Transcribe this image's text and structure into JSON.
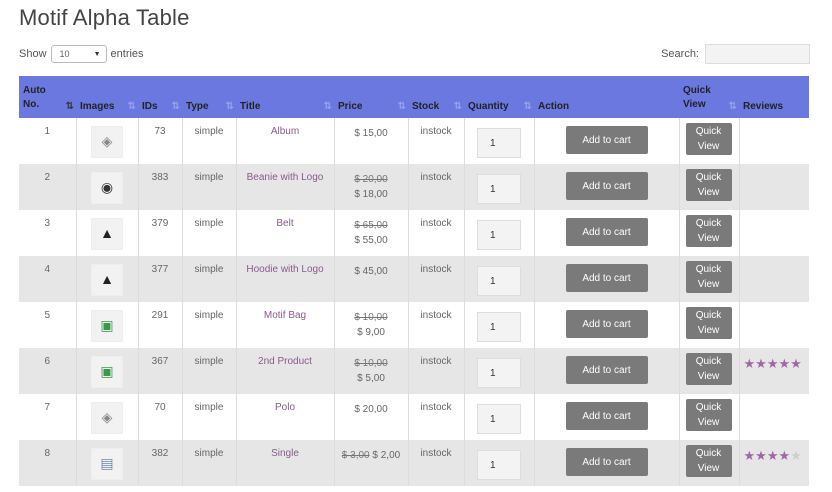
{
  "page": {
    "title": "Motif Alpha Table"
  },
  "controls": {
    "show_label": "Show",
    "entries_value": "10",
    "entries_label": "entries",
    "search_label": "Search:"
  },
  "table": {
    "headers": {
      "auto_no": "Auto No.",
      "images": "Images",
      "ids": "IDs",
      "type": "Type",
      "title": "Title",
      "price": "Price",
      "stock": "Stock",
      "quantity": "Quantity",
      "action": "Action",
      "quick_view": "Quick View",
      "reviews": "Reviews"
    },
    "rows": [
      {
        "no": "1",
        "id": "73",
        "type": "simple",
        "title": "Album",
        "old_price": "",
        "price": "$ 15,00",
        "stock": "instock",
        "qty": "1",
        "action": "Add to cart",
        "qv1": "Quick",
        "qv2": "View",
        "rating": 0,
        "thumb": "cd-icon"
      },
      {
        "no": "2",
        "id": "383",
        "type": "simple",
        "title": "Beanie with Logo",
        "old_price": "$ 20,00",
        "price": "$ 18,00",
        "stock": "instock",
        "qty": "1",
        "action": "Add to cart",
        "qv1": "Quick",
        "qv2": "View",
        "rating": 0,
        "thumb": "beanie-icon"
      },
      {
        "no": "3",
        "id": "379",
        "type": "simple",
        "title": "Belt",
        "old_price": "$ 65,00",
        "price": "$ 55,00",
        "stock": "instock",
        "qty": "1",
        "action": "Add to cart",
        "qv1": "Quick",
        "qv2": "View",
        "rating": 0,
        "thumb": "hoodie-icon"
      },
      {
        "no": "4",
        "id": "377",
        "type": "simple",
        "title": "Hoodie with Logo",
        "old_price": "",
        "price": "$ 45,00",
        "stock": "instock",
        "qty": "1",
        "action": "Add to cart",
        "qv1": "Quick",
        "qv2": "View",
        "rating": 0,
        "thumb": "hoodie-icon"
      },
      {
        "no": "5",
        "id": "291",
        "type": "simple",
        "title": "Motif Bag",
        "old_price": "$ 10,00",
        "price": "$ 9,00",
        "stock": "instock",
        "qty": "1",
        "action": "Add to cart",
        "qv1": "Quick",
        "qv2": "View",
        "rating": 0,
        "thumb": "bag-icon"
      },
      {
        "no": "6",
        "id": "367",
        "type": "simple",
        "title": "2nd Product",
        "old_price": "$ 10,00",
        "price": "$ 5,00",
        "stock": "instock",
        "qty": "1",
        "action": "Add to cart",
        "qv1": "Quick",
        "qv2": "View",
        "rating": 5,
        "thumb": "bag-icon"
      },
      {
        "no": "7",
        "id": "70",
        "type": "simple",
        "title": "Polo",
        "old_price": "",
        "price": "$ 20,00",
        "stock": "instock",
        "qty": "1",
        "action": "Add to cart",
        "qv1": "Quick",
        "qv2": "View",
        "rating": 0,
        "thumb": "cd-icon"
      },
      {
        "no": "8",
        "id": "382",
        "type": "simple",
        "title": "Single",
        "old_price": "$ 3,00",
        "price": "$ 2,00",
        "stock": "instock",
        "qty": "1",
        "action": "Add to cart",
        "qv1": "Quick",
        "qv2": "View",
        "rating": 4,
        "thumb": "poster-icon",
        "inline_price": true
      }
    ]
  },
  "colors": {
    "header_bg": "#6b78e0",
    "title_link": "#8a5a8a",
    "button_bg": "#7a7a7a",
    "star": "#a066a6"
  }
}
